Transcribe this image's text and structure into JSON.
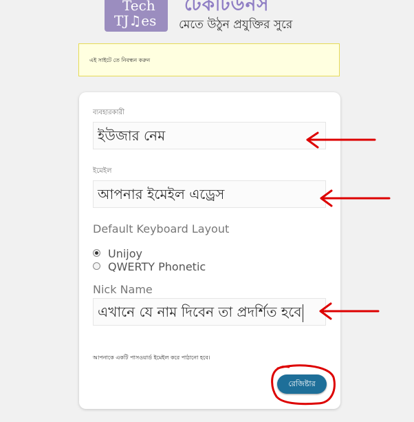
{
  "header": {
    "logo_line1": "Tech",
    "logo_line2": "TJ♫es",
    "site_name": "টেকটিউনস",
    "tagline": "মেতে উঠুন প্রযুক্তির সুরে"
  },
  "notice": {
    "text": "এই সাইটে তে নিবন্ধন করুন"
  },
  "form": {
    "username_label": "ব্যবহারকারী",
    "username_value": "ইউজার নেম",
    "email_label": "ইমেইল",
    "email_value": "আপনার ইমেইল এড্রেস",
    "keyboard_label": "Default Keyboard Layout",
    "keyboard_options": [
      "Unijoy",
      "QWERTY Phonetic"
    ],
    "keyboard_selected": "Unijoy",
    "nickname_label": "Nick Name",
    "nickname_value": "এখানে যে নাম দিবেন তা প্রদর্শিত হবে",
    "note": "আপনাকে একটি পাসওয়ার্ড ইমেইল করে পাঠানো হবে।",
    "register_label": "রেজিষ্টার"
  },
  "colors": {
    "annotation_red": "#dd0000",
    "button_blue": "#1e6f99",
    "notice_bg": "#ffffe0"
  }
}
